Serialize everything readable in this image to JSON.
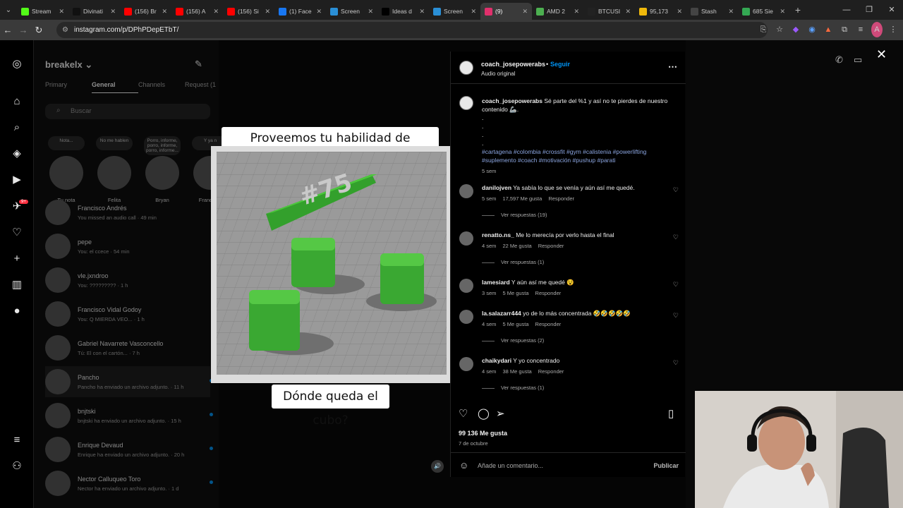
{
  "browser": {
    "tabs": [
      {
        "title": "Stream",
        "color": "#53fc18",
        "active": false
      },
      {
        "title": "Divinati",
        "color": "#111111",
        "active": false
      },
      {
        "title": "(156) Br",
        "color": "#ff0000",
        "active": false
      },
      {
        "title": "(156) A",
        "color": "#ff0000",
        "active": false
      },
      {
        "title": "(156) Si",
        "color": "#ff0000",
        "active": false
      },
      {
        "title": "(1) Face",
        "color": "#1877f2",
        "active": false
      },
      {
        "title": "Screen",
        "color": "#2a8fd6",
        "active": false
      },
      {
        "title": "Ideas d",
        "color": "#000000",
        "active": false
      },
      {
        "title": "Screen",
        "color": "#2a8fd6",
        "active": false
      },
      {
        "title": "(9)",
        "color": "#e1306c",
        "active": true
      },
      {
        "title": "AMD 2",
        "color": "#4caf50",
        "active": false
      },
      {
        "title": "BTCUSI",
        "color": "#222222",
        "active": false
      },
      {
        "title": "95,173",
        "color": "#f0b90b",
        "active": false
      },
      {
        "title": "Stash",
        "color": "#444444",
        "active": false
      },
      {
        "title": "685 Sie",
        "color": "#34a853",
        "active": false
      }
    ],
    "url": "instagram.com/p/DPhPDepETbT/"
  },
  "dm": {
    "username": "breakelx",
    "tabs": [
      "Primary",
      "General",
      "Channels",
      "Request (1"
    ],
    "active_tab": "General",
    "search_placeholder": "Buscar",
    "notes": [
      {
        "bubble": "Nota...",
        "label": "Tu nota"
      },
      {
        "bubble": "No me hablen",
        "label": "Felita"
      },
      {
        "bubble": "Porro, informe, porro, informe, porro, informe...",
        "label": "Bryan"
      },
      {
        "bubble": "Y ya n",
        "label": "Francisco"
      }
    ],
    "chats": [
      {
        "name": "Francisco Andrés",
        "snippet": "You missed an audio call · 49 min"
      },
      {
        "name": "pepe",
        "snippet": "You: el ccece · 54 min"
      },
      {
        "name": "vle.jxndroo",
        "snippet": "You: ????????? · 1 h"
      },
      {
        "name": "Francisco Vidal Godoy",
        "snippet": "You: Q MIERDA VEO... · 1 h"
      },
      {
        "name": "Gabriel Navarrete Vasconcello",
        "snippet": "Tú: El con el cartón... · 7 h"
      },
      {
        "name": "Pancho",
        "snippet": "Pancho ha enviado un archivo adjunto. · 11 h"
      },
      {
        "name": "bnjtski",
        "snippet": "bnjtski ha enviado un archivo adjunto. · 15 h"
      },
      {
        "name": "Enrique Devaud",
        "snippet": "Enrique ha enviado un archivo adjunto. · 20 h"
      },
      {
        "name": "Nector Calluqueo Toro",
        "snippet": "Nector ha enviado un archivo adjunto. · 1 d"
      }
    ]
  },
  "video": {
    "caption_top": "Proveemos tu habilidad de concentración",
    "caption_bottom": "Dónde queda el cubo?",
    "scene_label": "#75"
  },
  "post": {
    "username": "coach_josepowerabs",
    "follow": "Seguir",
    "audio": "Audio original",
    "caption_user": "coach_josepowerabs",
    "caption_text": "Sé parte del %1 y así no te pierdes de nuestro contenido 🦾.",
    "hashtags": "#cartagena #colombia #crossfit #gym #calistenia #powerlifting #suplemento #coach #motivación #pushup #parati",
    "caption_time": "5 sem",
    "comments": [
      {
        "user": "danilojven",
        "text": "Ya sabía lo que se venía y aún así me quedé.",
        "time": "5 sem",
        "likes": "17,597 Me gusta",
        "reply": "Responder",
        "replies": "Ver respuestas (19)"
      },
      {
        "user": "renatto.ns_",
        "text": "Me lo merecía por verlo hasta el final",
        "time": "4 sem",
        "likes": "22 Me gusta",
        "reply": "Responder",
        "replies": "Ver respuestas (1)"
      },
      {
        "user": "lamesiard",
        "text": "Y aún así me quedé 😵",
        "time": "3 sem",
        "likes": "5 Me gusta",
        "reply": "Responder",
        "replies": ""
      },
      {
        "user": "la.salazarr444",
        "text": "yo de lo más concentrada 🤣🤣🤣🤣🤣",
        "time": "4 sem",
        "likes": "5 Me gusta",
        "reply": "Responder",
        "replies": "Ver respuestas (2)"
      },
      {
        "user": "chaikydari",
        "text": "Y yo concentrado",
        "time": "4 sem",
        "likes": "38 Me gusta",
        "reply": "Responder",
        "replies": "Ver respuestas (1)"
      }
    ],
    "likes_total": "99 136 Me gusta",
    "date": "7 de octubre",
    "add_comment_placeholder": "Añade un comentario...",
    "publish": "Publicar"
  }
}
